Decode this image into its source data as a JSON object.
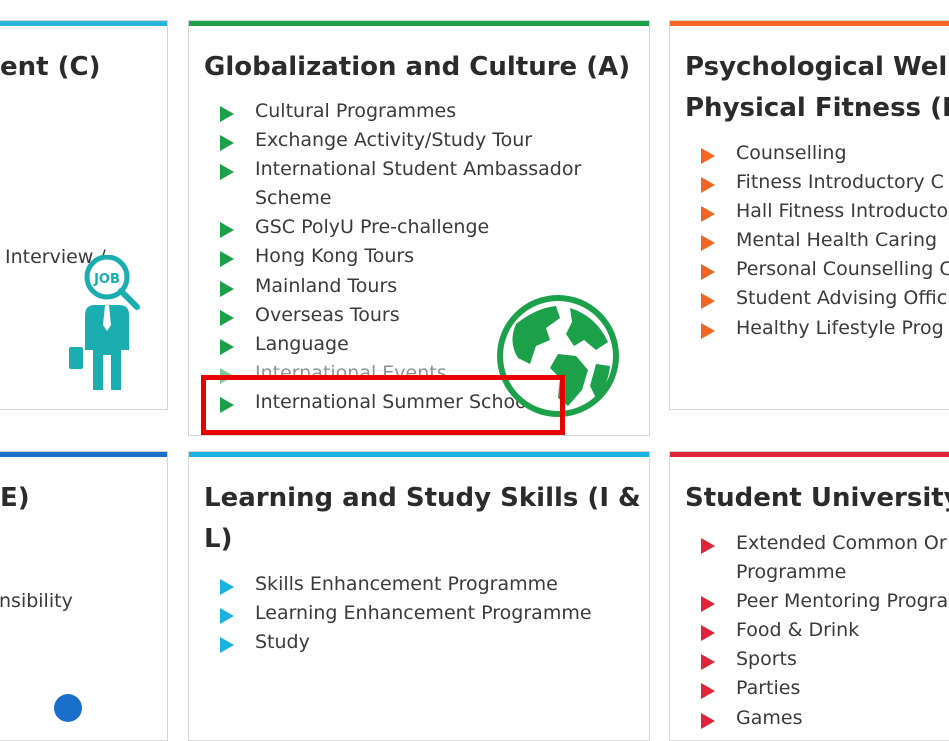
{
  "cards": {
    "career": {
      "title": "ent (C)",
      "fragment": "Interview /",
      "job_icon_text": "JOB",
      "accent": "#29b5d6"
    },
    "globalization": {
      "title": "Globalization and Culture (A)",
      "accent": "#1ca14a",
      "items": [
        "Cultural Programmes",
        "Exchange Activity/Study Tour",
        "International Student Ambassador",
        "Scheme",
        "GSC PolyU Pre-challenge",
        "Hong Kong Tours",
        "Mainland Tours",
        "Overseas Tours",
        "Language",
        "International Events",
        "International Summer School"
      ]
    },
    "psych": {
      "title_line1": "Psychological Well",
      "title_line2": "Physical Fitness (P)",
      "accent": "#f26522",
      "items": [
        "Counselling",
        "Fitness Introductory C",
        "Hall Fitness Introducto",
        "Mental Health Caring",
        "Personal Counselling C",
        "Student Advising Offic",
        "Healthy Lifestyle Prog"
      ]
    },
    "ethics": {
      "title": "E)",
      "fragment": "nsibility",
      "accent": "#1a6fc9"
    },
    "learning": {
      "title_line1": "Learning and Study Skills (I &",
      "title_line2": "L)",
      "accent": "#1ab2e2",
      "items": [
        "Skills Enhancement Programme",
        "Learning Enhancement Programme",
        "Study"
      ]
    },
    "university": {
      "title": "Student University",
      "accent": "#e0243a",
      "items": [
        "Extended Common Or",
        "Programme",
        "Peer Mentoring Progra",
        "Food & Drink",
        "Sports",
        "Parties",
        "Games"
      ]
    }
  },
  "highlight_color": "#e60000"
}
